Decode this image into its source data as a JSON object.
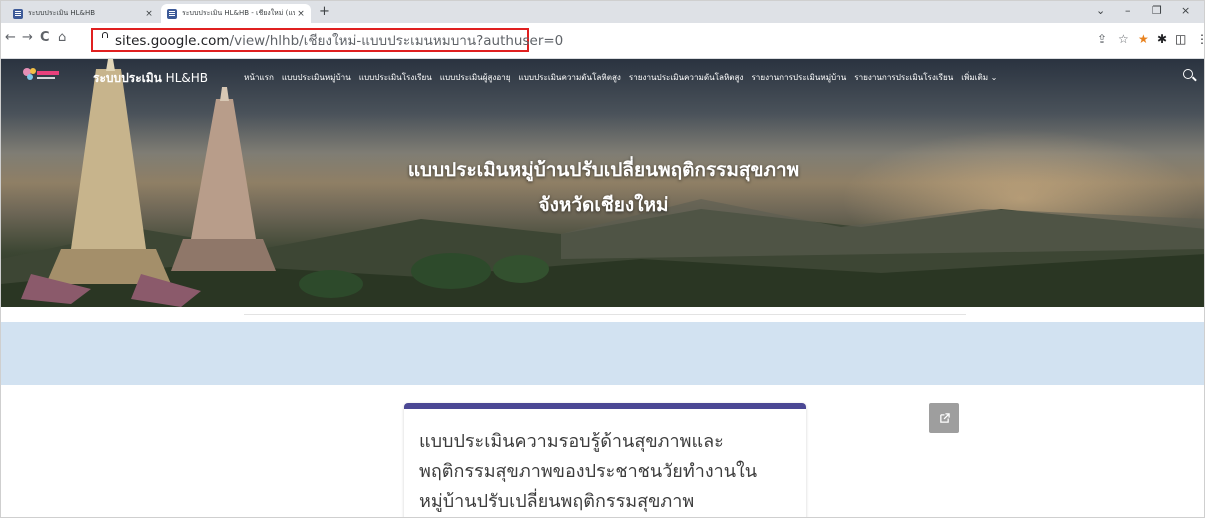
{
  "browser": {
    "tabs": [
      {
        "label": "ระบบประเมิน HL&HB",
        "close": "×"
      },
      {
        "label": "ระบบประเมิน HL&HB - เชียงใหม่ (แบ...",
        "close": "×"
      }
    ],
    "new_tab": "+",
    "window_controls": {
      "minimize": "–",
      "maximize": "❐",
      "close": "×",
      "dropdown": "⌄"
    },
    "nav": {
      "back": "←",
      "forward": "→",
      "reload": "C",
      "home": "⌂"
    },
    "url_host": "sites.google.com",
    "url_path": "/view/hlhb/เชียงใหม่-แบบประเมนหมบาน?authuser=0",
    "toolbar_icons": {
      "share": "⇪",
      "bookmark": "☆",
      "extension1": "★",
      "extensions": "✱",
      "sidebar": "◫",
      "menu": "⋮"
    },
    "accent_red": "#e02020"
  },
  "site": {
    "brand_bold": "ระบบประเมิน",
    "brand_light": " HL&HB",
    "menu": [
      "หน้าแรก",
      "แบบประเมินหมู่บ้าน",
      "แบบประเมินโรงเรียน",
      "แบบประเมินผู้สูงอายุ",
      "แบบประเมินความดันโลหิตสูง",
      "รายงานประเมินความดันโลหิตสูง",
      "รายงานการประเมินหมู่บ้าน",
      "รายงานการประเมินโรงเรียน",
      "เพิ่มเติม ⌄"
    ],
    "hero_title_line1": "แบบประเมินหมู่บ้านปรับเปลี่ยนพฤติกรรมสุขภาพ",
    "hero_title_line2": "จังหวัดเชียงใหม่",
    "band_color": "#d2e2f1",
    "card_accent": "#4b4894",
    "card_lines": [
      "แบบประเมินความรอบรู้ด้านสุขภาพและ",
      "พฤติกรรมสุขภาพของประชาชนวัยทำงานใน",
      "หมู่บ้านปรับเปลี่ยนพฤติกรรมสุขภาพ"
    ]
  }
}
